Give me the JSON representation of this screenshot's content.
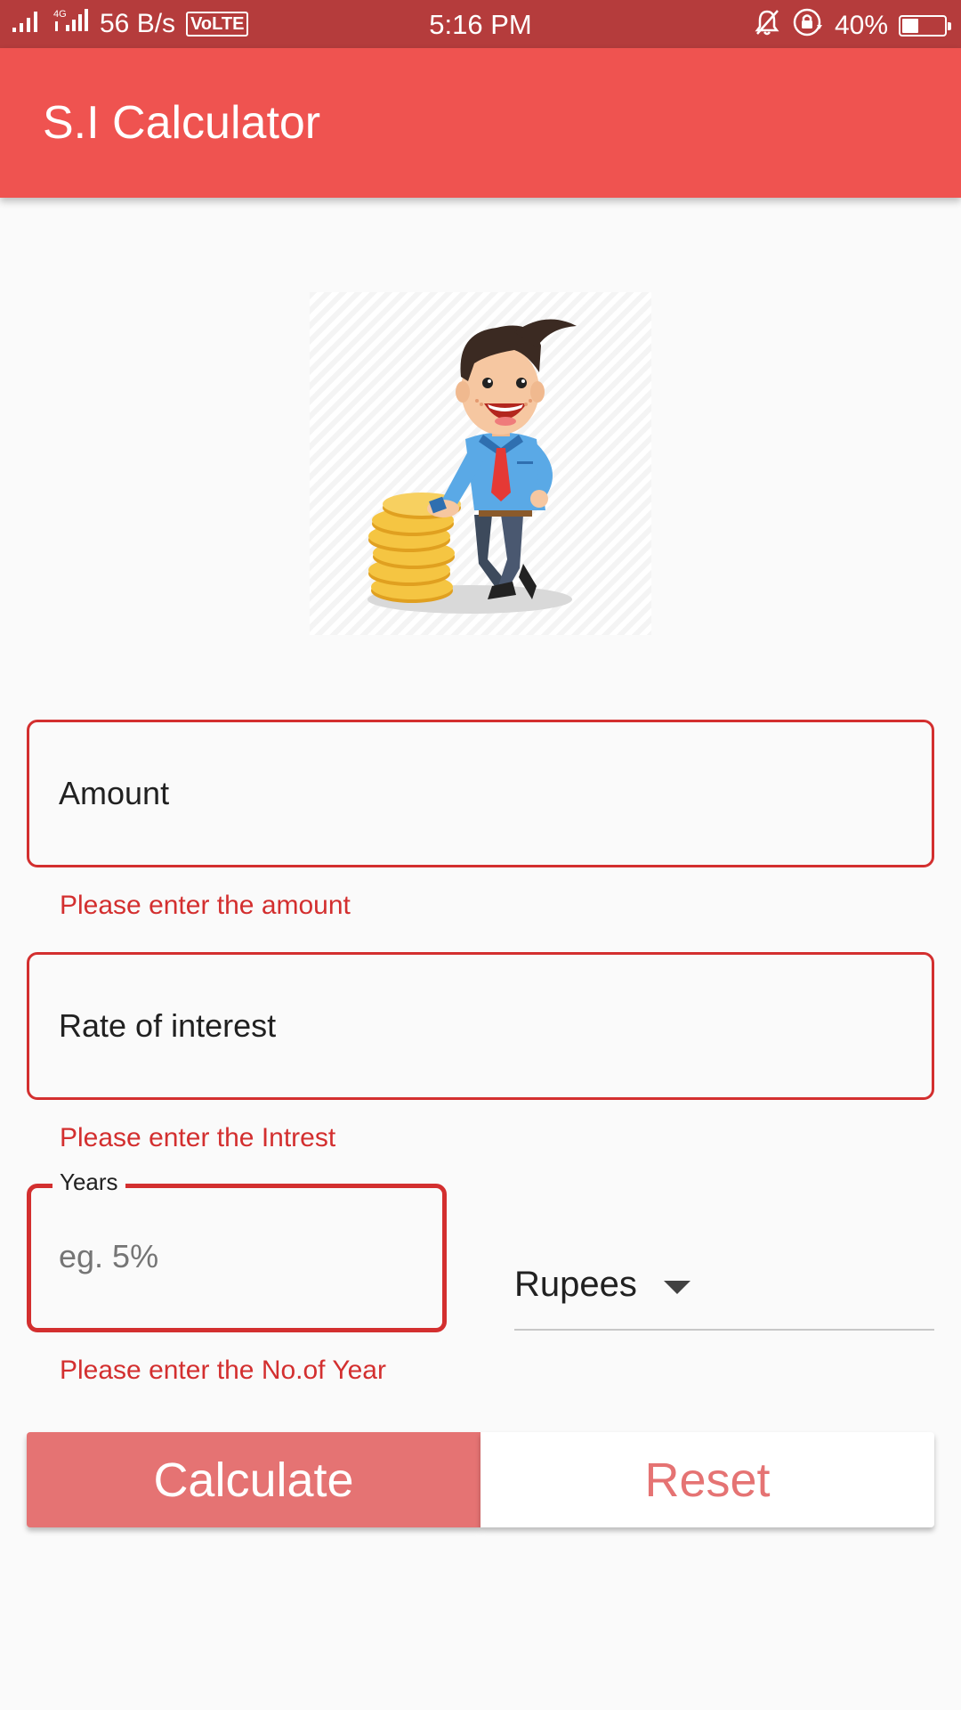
{
  "status_bar": {
    "network_speed": "56 B/s",
    "volte": "VoLTE",
    "network_type": "4G",
    "time": "5:16 PM",
    "battery_percent": "40%",
    "battery_level": 0.4
  },
  "app_bar": {
    "title": "S.I Calculator",
    "color": "#ef5350"
  },
  "illustration": {
    "name": "businessman-with-coins"
  },
  "form": {
    "amount": {
      "label": "Amount",
      "error": "Please enter the amount"
    },
    "rate": {
      "label": "Rate of interest",
      "error": "Please enter the Intrest"
    },
    "years": {
      "label": "Years",
      "placeholder": "eg. 5%",
      "value": "",
      "error": "Please enter the No.of Year"
    },
    "currency": {
      "selected": "Rupees"
    },
    "error_color": "#d32f2f"
  },
  "buttons": {
    "calculate": "Calculate",
    "reset": "Reset",
    "accent": "#e57373"
  }
}
